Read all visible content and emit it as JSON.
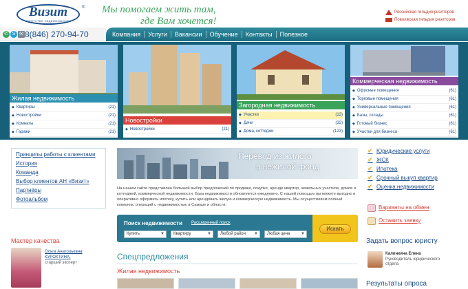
{
  "header": {
    "logo_text": "Визит",
    "logo_sub": "агентство недвижимости",
    "logo_reg": "®",
    "slogan_line1": "Мы помогаем жить там,",
    "slogan_line2": "где Вам хочется!",
    "guilds": [
      "Российская гильдия риэлторов",
      "Поволжская гильдия риэлторов"
    ]
  },
  "contact": {
    "phone": "8(846) 270-94-70",
    "icons": [
      "whatsapp-icon",
      "skype-icon",
      "email-icon"
    ]
  },
  "nav": [
    "Компания",
    "Услуги",
    "Вакансии",
    "Обучение",
    "Контакты",
    "Полезное"
  ],
  "tiles": [
    {
      "title": "Жилая недвижимость",
      "color": "#2a8fb0",
      "items": [
        {
          "label": "Квартиры",
          "count": "(21)"
        },
        {
          "label": "Новостройки",
          "count": "(21)"
        },
        {
          "label": "Комнаты",
          "count": "(21)"
        },
        {
          "label": "Гаражи",
          "count": "(21)"
        }
      ]
    },
    {
      "title": "Новостройки",
      "color": "#d9413a",
      "items": [
        {
          "label": "Новостройки",
          "count": "(21)"
        }
      ]
    },
    {
      "title": "Загородная недвижимость",
      "color": "#3aa35a",
      "items": [
        {
          "label": "Участки",
          "count": "(12)"
        },
        {
          "label": "Дачи",
          "count": "(32)"
        },
        {
          "label": "Дома, коттеджи",
          "count": "(123)"
        }
      ]
    },
    {
      "title": "Коммерческая недвижимость",
      "color": "#8a4a9e",
      "items": [
        {
          "label": "Офисные помещения",
          "count": "(61)"
        },
        {
          "label": "Торговые помещения",
          "count": "(61)"
        },
        {
          "label": "Универсальные помещения",
          "count": "(61)"
        },
        {
          "label": "Базы, склады",
          "count": "(61)"
        },
        {
          "label": "Готовый бизнес",
          "count": "(61)"
        },
        {
          "label": "Участки для бизнеса",
          "count": "(61)"
        }
      ]
    }
  ],
  "left_links": [
    "Принципы работы с клиентами",
    "История",
    "Команда",
    "Выбор клиентов АН «Визит»",
    "Партнёры",
    "Фотоальбом"
  ],
  "master": {
    "title": "Мастер качества",
    "name": "Ольга Анатольевна КУРОХТИНА,",
    "role": "старший эксперт"
  },
  "banner": {
    "line1": "Перевод из жилого",
    "line2": "в нежилой фонд"
  },
  "about_text": "На нашем сайте представлен большой выбор предложений по продаже, покупке, аренде квартир, земельных участков, домов и коттеджей, коммерческой недвижимости. База недвижимости обновляется ежедневно. С нашей помощью вы можете выгодно и оперативно оформить ипотеку, купить или арендовать жилую и коммерческую недвижимость. Мы осуществляем полный комплекс операций с недвижимостью в Самаре и области.",
  "search": {
    "title": "Поиск недвижимости",
    "advanced": "Расширенный поиск",
    "selects": [
      "Купить",
      "Квартиру",
      "Любой район",
      "Любая цена"
    ],
    "button": "Искать"
  },
  "specials": {
    "title": "Спецпредложения",
    "subtitle": "Жилая недвижимость"
  },
  "services": [
    "Юридические услуги",
    "ЖСК",
    "Ипотека",
    "Срочный выкуп квартир",
    "Оценка недвижимости"
  ],
  "variants": [
    "Варианты на обмен",
    "Оставить заявку"
  ],
  "lawyer": {
    "heading": "Задать вопрос юристу",
    "name": "Калинкина Елена",
    "role": "Руководитель юридического отдела"
  },
  "poll_heading": "Результаты опроса"
}
